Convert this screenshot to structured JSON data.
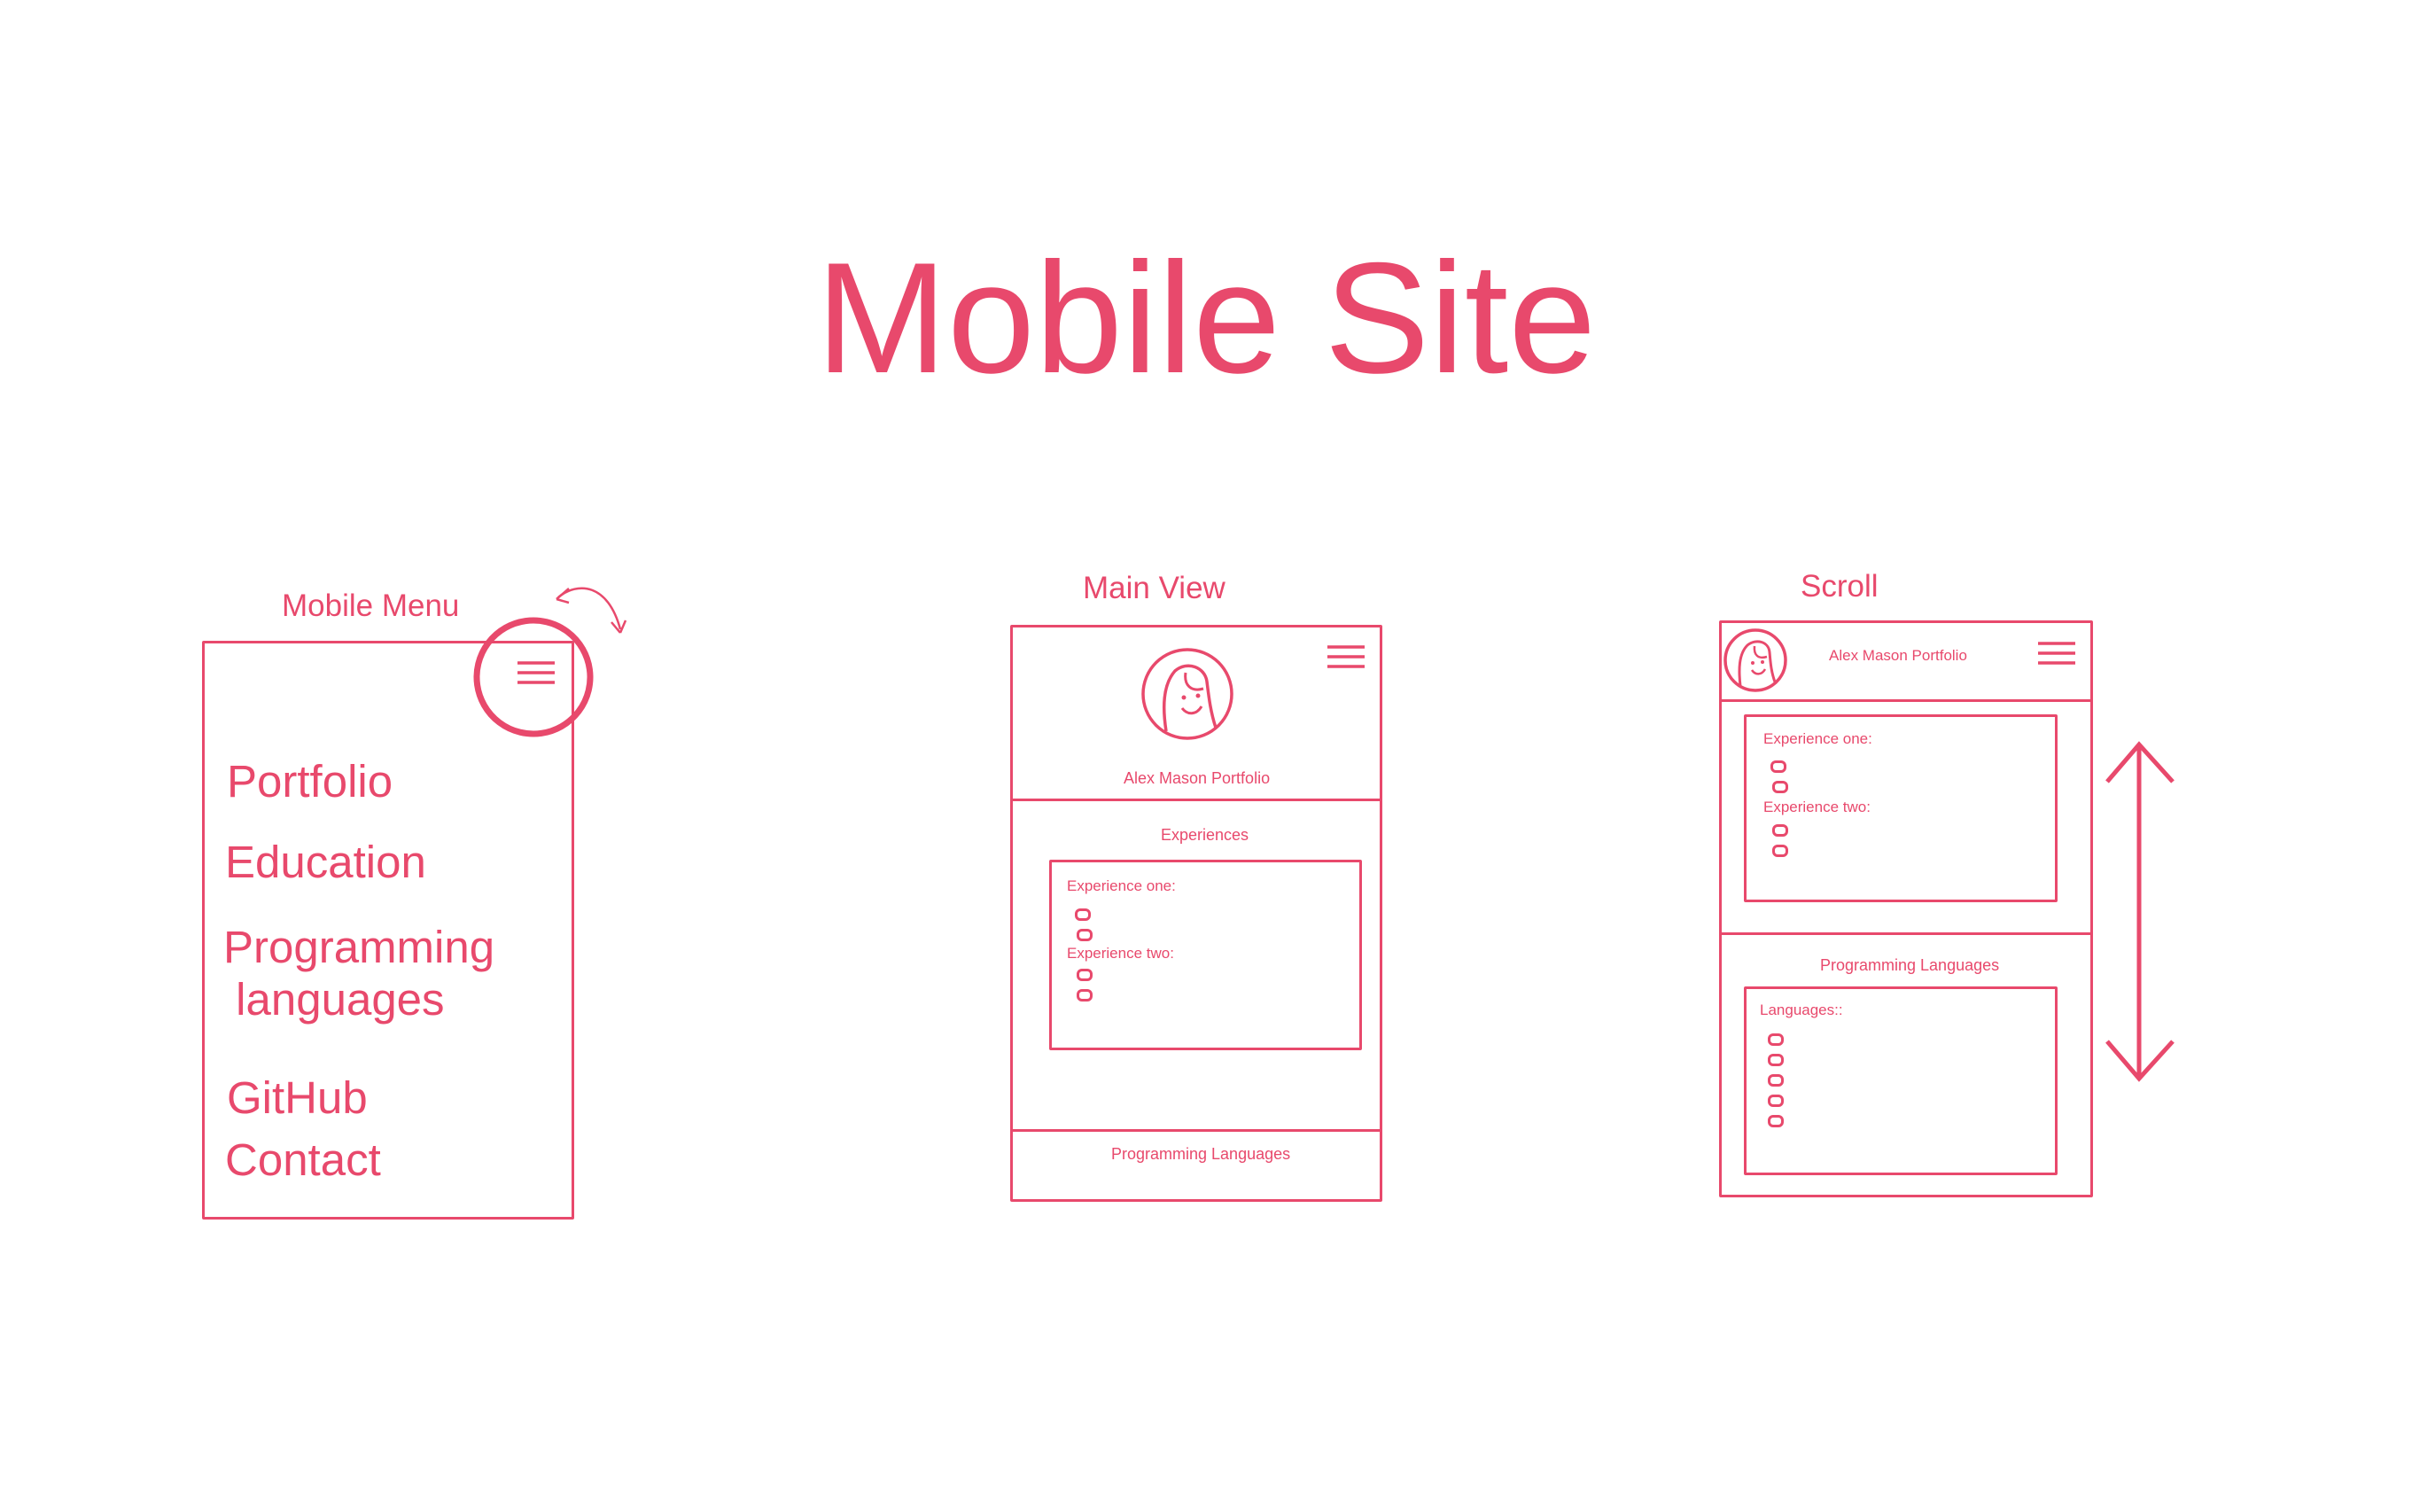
{
  "colors": {
    "accent": "#e8496c",
    "background": "#ffffff"
  },
  "title": "Mobile Site",
  "mobile_menu": {
    "label": "Mobile Menu",
    "items": [
      "Portfolio",
      "Education",
      "Programming\n languages",
      "GitHub",
      "Contact"
    ]
  },
  "main_view": {
    "label": "Main View",
    "portfolio_name": "Alex Mason Portfolio",
    "experiences_heading": "Experiences",
    "experience_one": "Experience one:",
    "experience_two": "Experience two:",
    "programming_heading": "Programming Languages"
  },
  "scroll_view": {
    "label": "Scroll",
    "portfolio_name": "Alex Mason Portfolio",
    "experience_one": "Experience one:",
    "experience_two": "Experience two:",
    "programming_heading": "Programming Languages",
    "languages_label": "Languages::"
  },
  "icons": [
    "hamburger-icon",
    "avatar-face-icon",
    "rotate-arrow-icon",
    "vertical-double-arrow-icon"
  ]
}
